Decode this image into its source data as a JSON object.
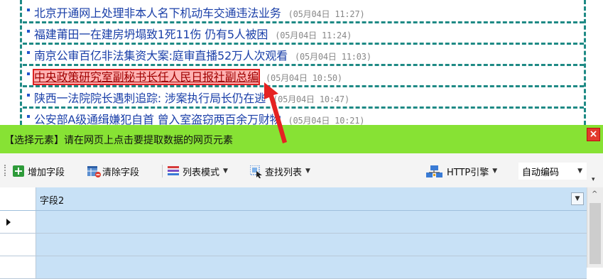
{
  "news": [
    {
      "title": "北京开通网上处理非本人名下机动车交通违法业务",
      "time": "(05月04日 11:27)"
    },
    {
      "title": "福建莆田一在建房坍塌致1死11伤 仍有5人被困",
      "time": "(05月04日 11:24)"
    },
    {
      "title": "南京公审百亿非法集资大案:庭审直播52万人次观看",
      "time": "(05月04日 11:03)"
    },
    {
      "title": "中央政策研究室副秘书长任人民日报社副总编",
      "time": "(05月04日 10:50)"
    },
    {
      "title": "陕西一法院院长遇刺追踪: 涉案执行局长仍在逃",
      "time": "(05月04日 10:47)"
    },
    {
      "title": "公安部A级通缉嫌犯自首 曾入室盗窃两百余万财物",
      "time": "(05月04日 10:21)"
    }
  ],
  "hint": {
    "text": "【选择元素】请在网页上点击要提取数据的网页元素",
    "close": "×"
  },
  "toolbar": {
    "add_field": "增加字段",
    "clear_field": "清除字段",
    "list_mode": "列表模式",
    "find_list": "查找列表",
    "http_engine": "HTTP引擎",
    "encoding": "自动编码"
  },
  "grid": {
    "column": "字段2"
  },
  "colors": {
    "accent_green": "#87e234",
    "dash": "#1e8a85",
    "link": "#1a3fa8",
    "selected_bg": "#ffb2b2",
    "grid_blue": "#c8e1f6"
  }
}
